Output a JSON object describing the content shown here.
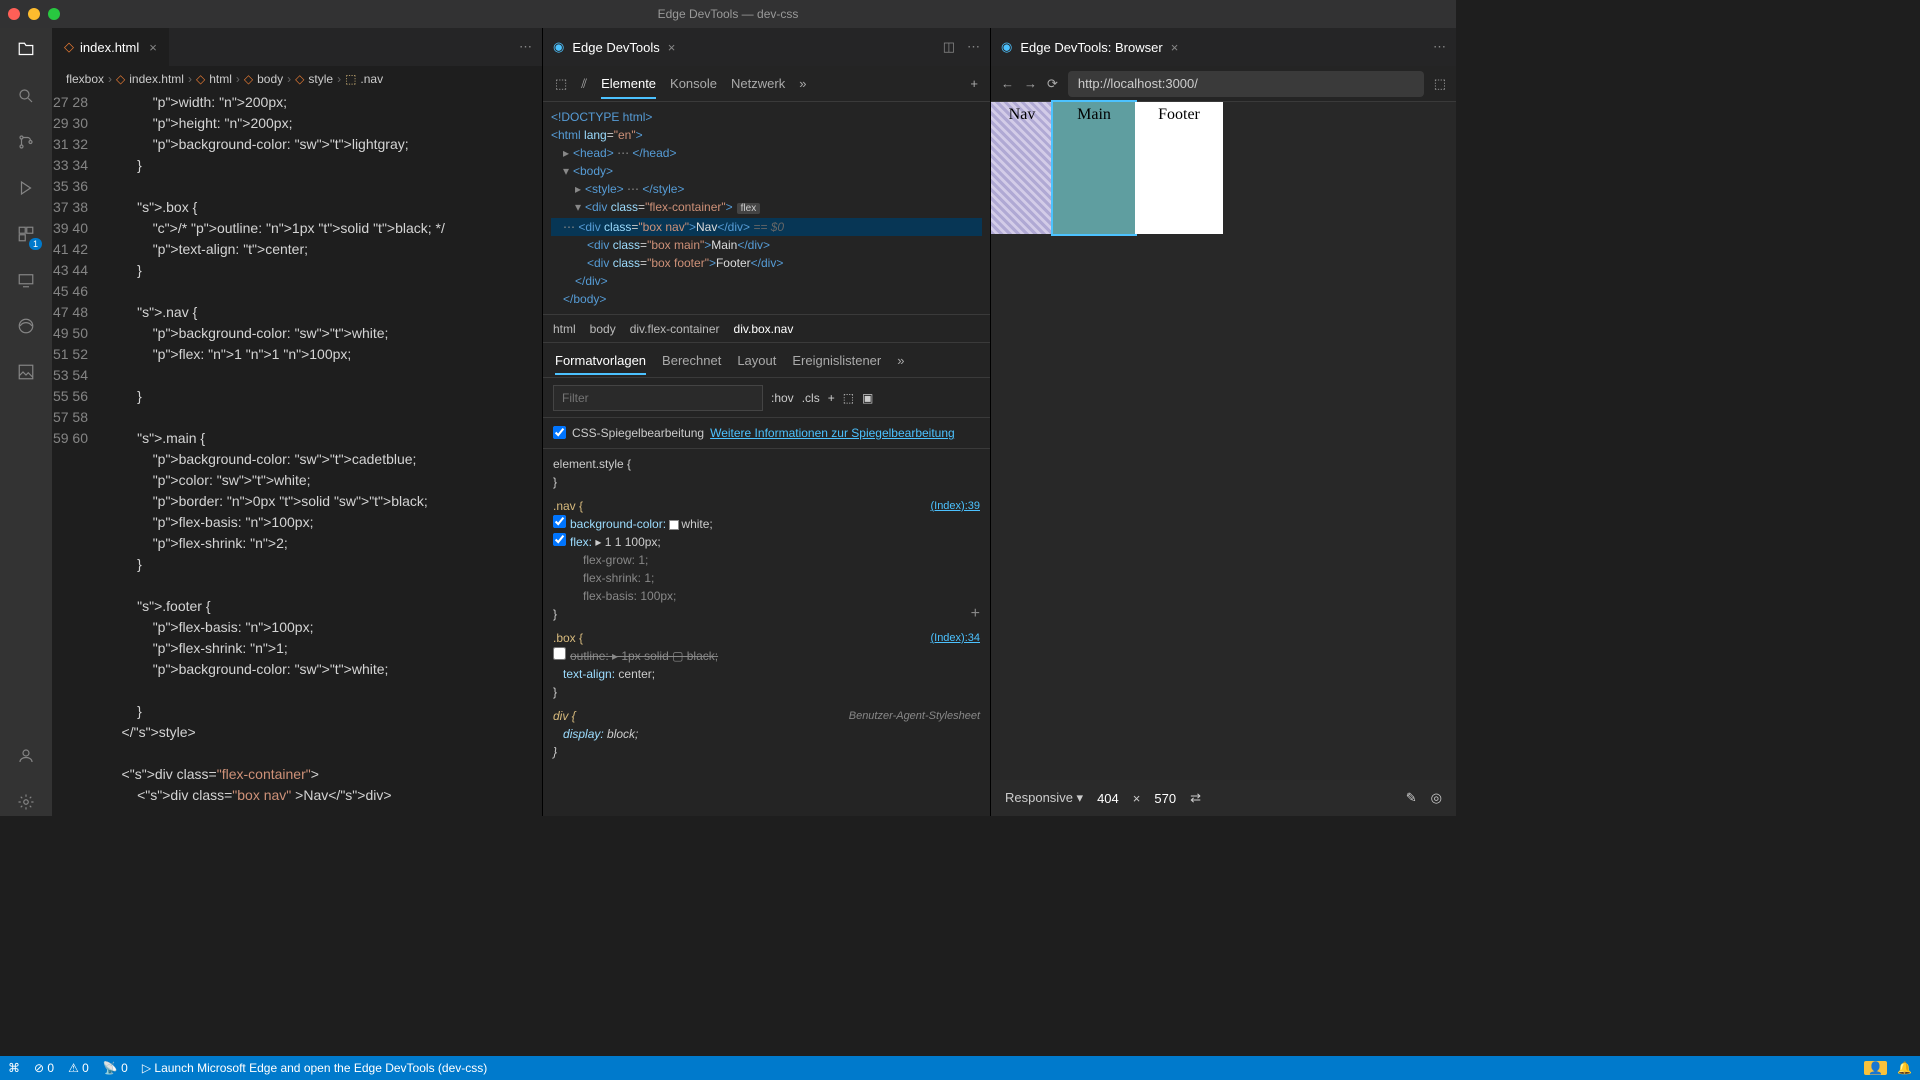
{
  "window": {
    "title": "Edge DevTools — dev-css"
  },
  "editor": {
    "tab_file": "index.html",
    "breadcrumbs": [
      "flexbox",
      "index.html",
      "html",
      "body",
      "style",
      ".nav"
    ],
    "lines_start": 27,
    "code": [
      "            width: 200px;",
      "            height: 200px;",
      "            background-color: ▢lightgray;",
      "        }",
      "",
      "        .box {",
      "            /* outline: 1px solid black; */",
      "            text-align: center;",
      "        }",
      "",
      "        .nav {",
      "            background-color: ▢white;",
      "            flex: 1 1 100px;",
      "",
      "        }",
      "",
      "        .main {",
      "            background-color: ▢cadetblue;",
      "            color: ▢white;",
      "            border: 0px solid ▢black;",
      "            flex-basis: 100px;",
      "            flex-shrink: 2;",
      "        }",
      "",
      "        .footer {",
      "            flex-basis: 100px;",
      "            flex-shrink: 1;",
      "            background-color: ▢white;",
      "",
      "        }",
      "    </style>",
      "",
      "    <div class=\"flex-container\">",
      "        <div class=\"box nav\" >Nav</div>"
    ]
  },
  "devtools": {
    "tab_label": "Edge DevTools",
    "toolbar": [
      "Elemente",
      "Konsole",
      "Netzwerk"
    ],
    "dom_crumb": [
      "html",
      "body",
      "div.flex-container",
      "div.box.nav"
    ],
    "style_tabs": [
      "Formatvorlagen",
      "Berechnet",
      "Layout",
      "Ereignislistener"
    ],
    "filter_placeholder": "Filter",
    "hov": ":hov",
    "cls": ".cls",
    "mirror_label": "CSS-Spiegelbearbeitung",
    "mirror_link": "Weitere Informationen zur Spiegelbearbeitung",
    "rules": {
      "element_style": "element.style {",
      "nav_sel": ".nav {",
      "nav_src": "(Index):39",
      "nav_bg": "background-color:",
      "nav_bg_v": "white;",
      "nav_flex": "flex:",
      "nav_flex_v": "▸ 1 1 100px;",
      "fg": "flex-grow: 1;",
      "fs": "flex-shrink: 1;",
      "fb": "flex-basis: 100px;",
      "box_sel": ".box {",
      "box_src": "(Index):34",
      "box_outline": "outline: ▸ 1px solid ▢ black;",
      "box_ta": "text-align:",
      "box_ta_v": "center;",
      "div_sel": "div {",
      "ua": "Benutzer-Agent-Stylesheet",
      "div_disp": "display:",
      "div_disp_v": "block;"
    },
    "dom": {
      "doctype": "<!DOCTYPE html>",
      "html_open": "<html lang=\"en\">",
      "head": "<head> ⋯ </head>",
      "body_open": "<body>",
      "style": "<style> ⋯ </style>",
      "fc_open": "<div class=\"flex-container\">",
      "flex_badge": "flex",
      "nav_line": "<div class=\"box nav\">Nav</div>",
      "nav_hint": " == $0",
      "main_line": "<div class=\"box main\">Main</div>",
      "footer_line": "<div class=\"box footer\">Footer</div>",
      "div_close": "</div>",
      "body_close": "</body>"
    }
  },
  "browser": {
    "tab_label": "Edge DevTools: Browser",
    "url": "http://localhost:3000/",
    "nav": "Nav",
    "main": "Main",
    "footer": "Footer",
    "responsive": "Responsive",
    "w": "404",
    "x": "×",
    "h": "570"
  },
  "status": {
    "errors": "0",
    "warnings": "0",
    "port": "0",
    "launch": "Launch Microsoft Edge and open the Edge DevTools (dev-css)"
  }
}
